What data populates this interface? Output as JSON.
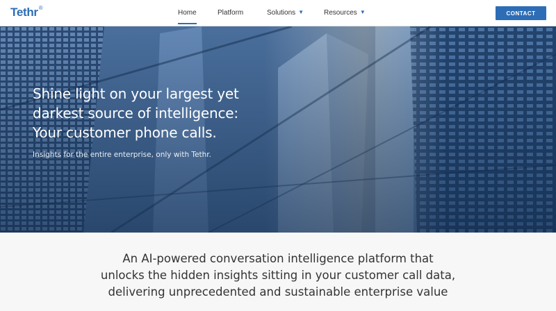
{
  "header": {
    "logo": "Tethr",
    "logo_mark": "®",
    "nav": [
      {
        "label": "Home",
        "active": true
      },
      {
        "label": "Platform",
        "active": false
      },
      {
        "label": "Solutions",
        "active": false,
        "has_dropdown": true
      },
      {
        "label": "Resources",
        "active": false,
        "has_dropdown": true
      }
    ],
    "dropdown_icon": "chevron-down-icon",
    "contact_label": "CONTACT"
  },
  "hero": {
    "title_lines": [
      "Shine light on your largest yet",
      "darkest source of intelligence:",
      "Your customer phone calls."
    ],
    "subtitle": "Insights for the entire enterprise, only with Tethr."
  },
  "value": {
    "lines": [
      "An AI-powered conversation intelligence platform that",
      "unlocks the hidden insights sitting in your customer call data,",
      "delivering unprecedented and sustainable enterprise value"
    ]
  },
  "colors": {
    "brand": "#2d6db5",
    "hero_dark": "#1c3a62",
    "section_bg": "#f7f7f7"
  }
}
